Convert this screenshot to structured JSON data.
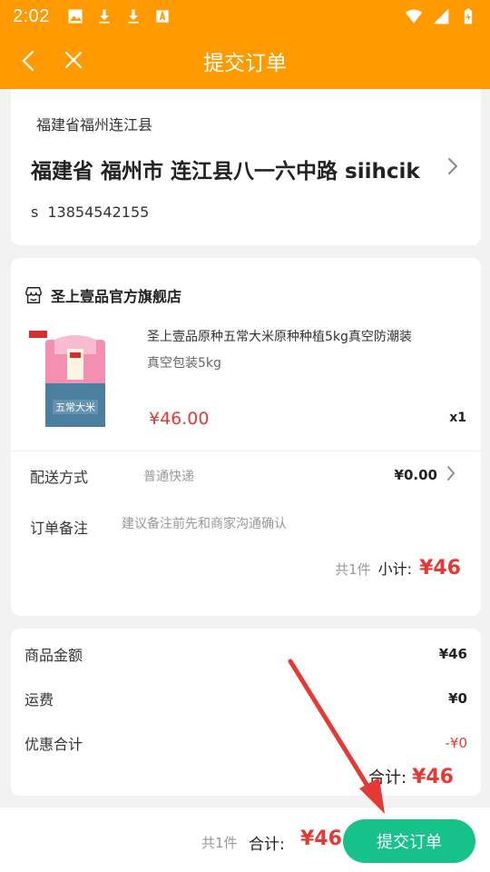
{
  "status_bar": {
    "time": "2:02"
  },
  "nav": {
    "title": "提交订单"
  },
  "address": {
    "region": "福建省福州连江县",
    "full": "福建省 福州市 连江县八一六中路 siihcik",
    "contact_name": "s",
    "contact_phone": "13854542155"
  },
  "order": {
    "store_name": "圣上壹品官方旗舰店",
    "product_title": "圣上壹品原种五常大米原种种植5kg真空防潮装",
    "product_spec": "真空包装5kg",
    "product_price": "¥46.00",
    "product_qty": "x1",
    "delivery_label": "配送方式",
    "delivery_method": "普通快递",
    "delivery_fee": "¥0.00",
    "note_label": "订单备注",
    "note_placeholder": "建议备注前先和商家沟通确认",
    "subtotal_count": "共1件",
    "subtotal_label": "小计:",
    "subtotal_amount": "¥46"
  },
  "summary": {
    "rows": [
      {
        "label": "商品金额",
        "value": "¥46"
      },
      {
        "label": "运费",
        "value": "¥0"
      },
      {
        "label": "优惠合计",
        "value": "-¥0"
      }
    ],
    "total_label": "合计:",
    "total_amount": "¥46"
  },
  "bottom_bar": {
    "count": "共1件",
    "total_label": "合计:",
    "total_amount": "¥46",
    "submit_label": "提交订单"
  },
  "colors": {
    "brand_orange": "#ff9a00",
    "price_red": "#e53935",
    "submit_green": "#16c289"
  },
  "icons": [
    "image-icon",
    "download-icon",
    "download-icon",
    "font-icon",
    "wifi-icon",
    "signal-icon",
    "battery-icon",
    "back-arrow-icon",
    "close-icon",
    "chevron-right-icon",
    "store-icon"
  ]
}
